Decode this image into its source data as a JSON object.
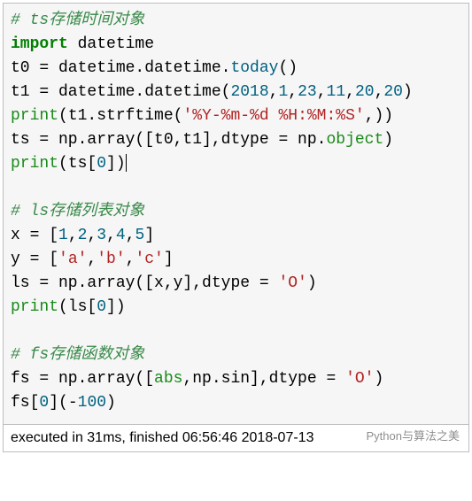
{
  "code": {
    "l1_c": "# ts存储时间对象",
    "l2_kw": "import",
    "l2_mod": " datetime",
    "l3_a": "t0 = datetime.datetime.",
    "l3_fn": "today",
    "l3_b": "()",
    "l4_a": "t1 = datetime.datetime(",
    "l4_n1": "2018",
    "l4_n2": "1",
    "l4_n3": "23",
    "l4_n4": "11",
    "l4_n5": "20",
    "l4_n6": "20",
    "l4_b": ")",
    "l5_fn": "print",
    "l5_a": "(t1.strftime(",
    "l5_s": "'%Y-%m-%d %H:%M:%S'",
    "l5_b": ",))",
    "l6_a": "ts = np.array([t0,t1],dtype = np.",
    "l6_fn": "object",
    "l6_b": ")",
    "l7_fn": "print",
    "l7_a": "(ts[",
    "l7_n": "0",
    "l7_b": "])",
    "blank": "",
    "l9_c": "# ls存储列表对象",
    "l10_a": "x = [",
    "l10_n1": "1",
    "l10_n2": "2",
    "l10_n3": "3",
    "l10_n4": "4",
    "l10_n5": "5",
    "l10_b": "]",
    "l11_a": "y = [",
    "l11_s1": "'a'",
    "l11_s2": "'b'",
    "l11_s3": "'c'",
    "l11_b": "]",
    "l12_a": "ls = np.array([x,y],dtype = ",
    "l12_s": "'O'",
    "l12_b": ")",
    "l13_fn": "print",
    "l13_a": "(ls[",
    "l13_n": "0",
    "l13_b": "])",
    "l15_c": "# fs存储函数对象",
    "l16_a": "fs = np.array([",
    "l16_fn1": "abs",
    "l16_m": ",np.sin],dtype = ",
    "l16_s": "'O'",
    "l16_b": ")",
    "l17_a": "fs[",
    "l17_n0": "0",
    "l17_b": "](",
    "l17_neg": "-",
    "l17_n100": "100",
    "l17_c": ")"
  },
  "status": "executed in 31ms, finished 06:56:46 2018-07-13",
  "watermark": "Python与算法之美"
}
